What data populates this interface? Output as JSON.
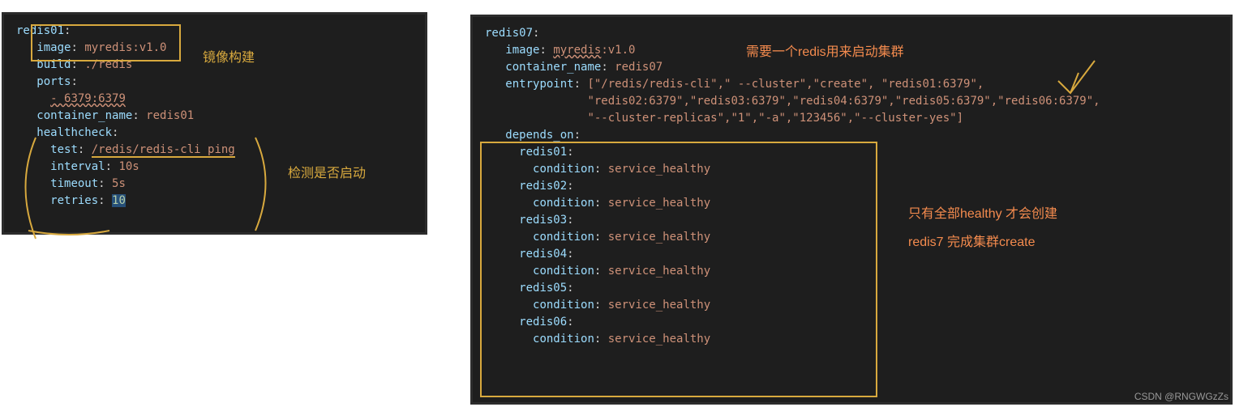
{
  "left": {
    "service": "redis01",
    "image_key": "image",
    "image_val": "myredis:v1.0",
    "build_key": "build",
    "build_val": "./redis",
    "ports_key": "ports",
    "ports_val": "- 6379:6379",
    "container_name_key": "container_name",
    "container_name_val": "redis01",
    "healthcheck_key": "healthcheck",
    "test_key": "test",
    "test_val": "/redis/redis-cli ping",
    "interval_key": "interval",
    "interval_val": "10s",
    "timeout_key": "timeout",
    "timeout_val": "5s",
    "retries_key": "retries",
    "retries_val": "10"
  },
  "right": {
    "service": "redis07",
    "image_key": "image",
    "image_val_1": "myredis",
    "image_val_2": ":v1.0",
    "container_name_key": "container_name",
    "container_name_val": "redis07",
    "entrypoint_key": "entrypoint",
    "entrypoint_line1": "[\"/redis/redis-cli\",\" --cluster\",\"create\", \"redis01:6379\",",
    "entrypoint_line2": "\"redis02:6379\",\"redis03:6379\",\"redis04:6379\",\"redis05:6379\",\"redis06:6379\",",
    "entrypoint_line3": "\"--cluster-replicas\",\"1\",\"-a\",\"123456\",\"--cluster-yes\"]",
    "depends_on_key": "depends_on",
    "deps": [
      {
        "name": "redis01",
        "condition_key": "condition",
        "condition_val": "service_healthy"
      },
      {
        "name": "redis02",
        "condition_key": "condition",
        "condition_val": "service_healthy"
      },
      {
        "name": "redis03",
        "condition_key": "condition",
        "condition_val": "service_healthy"
      },
      {
        "name": "redis04",
        "condition_key": "condition",
        "condition_val": "service_healthy"
      },
      {
        "name": "redis05",
        "condition_key": "condition",
        "condition_val": "service_healthy"
      },
      {
        "name": "redis06",
        "condition_key": "condition",
        "condition_val": "service_healthy"
      }
    ]
  },
  "annotations": {
    "image_build": "镜像构建",
    "health_detect": "检测是否启动",
    "need_redis": "需要一个redis用来启动集群",
    "only_healthy": "只有全部healthy 才会创建",
    "redis7_complete": "redis7 完成集群create"
  },
  "watermark": "CSDN @RNGWGzZs"
}
